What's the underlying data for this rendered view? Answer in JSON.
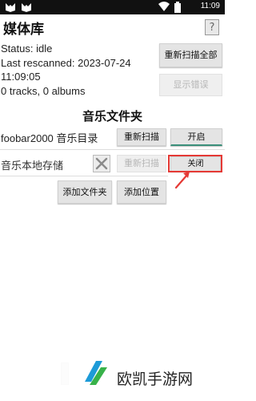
{
  "status_bar": {
    "time": "11:09",
    "icons": [
      "app-logo-icon",
      "wifi-icon",
      "battery-icon"
    ]
  },
  "header": {
    "title": "媒体库",
    "help_label": "?"
  },
  "library": {
    "status": "Status: idle",
    "last_rescanned_line1": "Last rescanned: 2023-07-24",
    "last_rescanned_line2": "11:09:05",
    "counts": "0 tracks, 0 albums",
    "rescan_all_label": "重新扫描全部",
    "show_errors_label": "显示错误"
  },
  "folders": {
    "section_title": "音乐文件夹",
    "rows": [
      {
        "name": "foobar2000 音乐目录",
        "rescan_label": "重新扫描",
        "toggle_label": "开启"
      },
      {
        "name": "音乐本地存储",
        "rescan_label": "重新扫描",
        "toggle_label": "关闭"
      }
    ],
    "add_folder_label": "添加文件夹",
    "add_location_label": "添加位置"
  },
  "watermark": {
    "text": "欧凯手游网"
  },
  "colors": {
    "highlight": "#e53935",
    "toggle_accent": "#3a8f7a"
  }
}
